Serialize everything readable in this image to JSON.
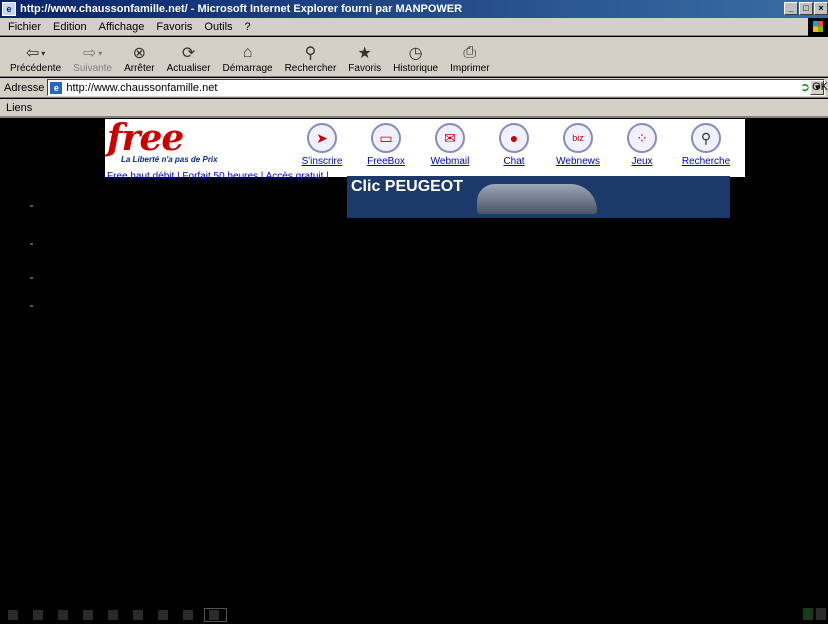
{
  "window": {
    "title": "http://www.chaussonfamille.net/ - Microsoft Internet Explorer fourni par MANPOWER",
    "controls": [
      "_",
      "□",
      "×"
    ]
  },
  "menu": [
    "Fichier",
    "Edition",
    "Affichage",
    "Favoris",
    "Outils",
    "?"
  ],
  "toolbar": {
    "back": "Précédente",
    "forward": "Suivante",
    "stop": "Arrêter",
    "refresh": "Actualiser",
    "home": "Démarrage",
    "search": "Rechercher",
    "favorites": "Favoris",
    "history": "Historique",
    "print": "Imprimer"
  },
  "address": {
    "label": "Adresse",
    "url": "http://www.chaussonfamille.net",
    "go": "OK"
  },
  "links": {
    "label": "Liens"
  },
  "banner": {
    "logo": "free",
    "tagline": "La Liberté n'a pas de Prix",
    "nav": [
      "S'inscrire",
      "FreeBox",
      "Webmail",
      "Chat",
      "Webnews",
      "Jeux",
      "Recherche"
    ],
    "sublinks": "Free haut débit | Forfait 50 heures | Accès gratuit |",
    "ad": {
      "brand": "Clic PEUGEOT"
    }
  },
  "colors": {
    "free_red": "#cc0000",
    "link_blue": "#0000cc"
  }
}
